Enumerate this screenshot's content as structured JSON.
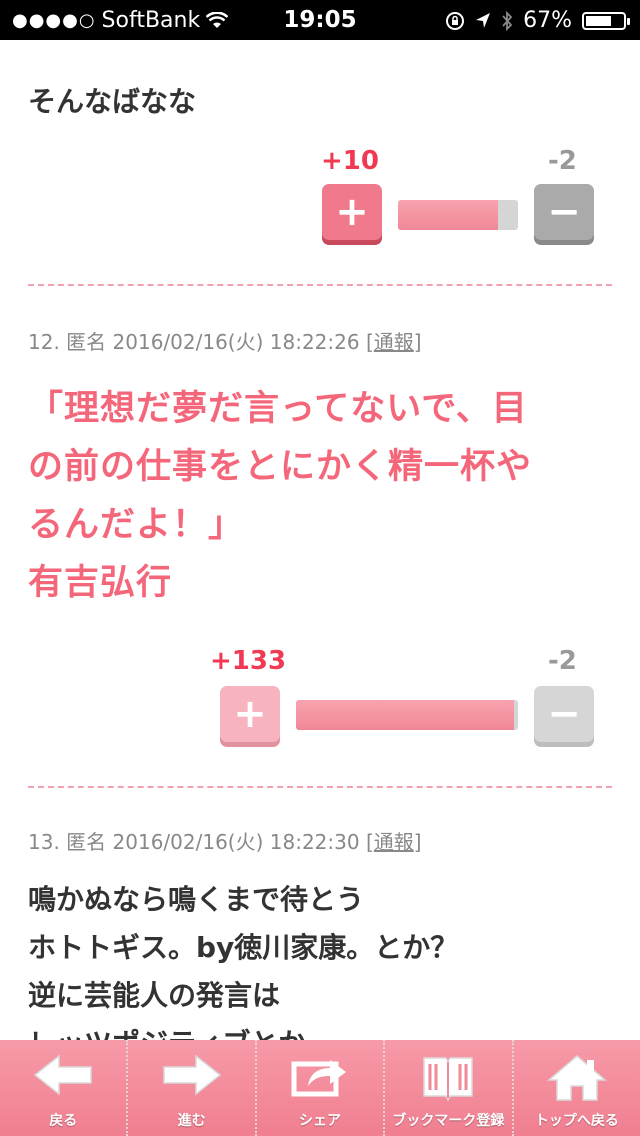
{
  "status_bar": {
    "signal_dots": "●●●●○",
    "carrier": "SoftBank",
    "time": "19:05",
    "battery": "67%",
    "battery_level": 0.67
  },
  "comments": [
    {
      "text_lines": [
        "そんなばなな"
      ],
      "plus_count": "+10",
      "minus_count": "-2",
      "plus_label": "+",
      "minus_label": "−",
      "bar_ratio": 0.83
    },
    {
      "number": "12.",
      "author": "匿名",
      "datetime": "2016/02/16(火) 18:22:26",
      "report_bracket_open": "[",
      "report": "通報",
      "report_bracket_close": "]",
      "text_lines": [
        "「理想だ夢だ言ってないで、目",
        "の前の仕事をとにかく精一杯や",
        "るんだよ！」",
        "有吉弘行"
      ],
      "plus_count": "+133",
      "minus_count": "-2",
      "plus_label": "+",
      "minus_label": "−",
      "bar_ratio": 0.98
    },
    {
      "number": "13.",
      "author": "匿名",
      "datetime": "2016/02/16(火) 18:22:30",
      "report_bracket_open": "[",
      "report": "通報",
      "report_bracket_close": "]",
      "text_lines": [
        "鳴かぬなら鳴くまで待とう",
        "ホトトギス。by徳川家康。とか？",
        "逆に芸能人の発言は",
        "レッツポジティブとか"
      ]
    }
  ],
  "toolbar": {
    "items": [
      {
        "label": "戻る",
        "icon": "left-arrow-icon"
      },
      {
        "label": "進む",
        "icon": "right-arrow-icon"
      },
      {
        "label": "シェア",
        "icon": "share-icon"
      },
      {
        "label": "ブックマーク登録",
        "icon": "book-icon"
      },
      {
        "label": "トップへ戻る",
        "icon": "home-icon"
      }
    ]
  },
  "colors": {
    "accent_pink": "#f4677a",
    "plus_red": "#f03a54",
    "toolbar_pink": "#f07f90"
  }
}
